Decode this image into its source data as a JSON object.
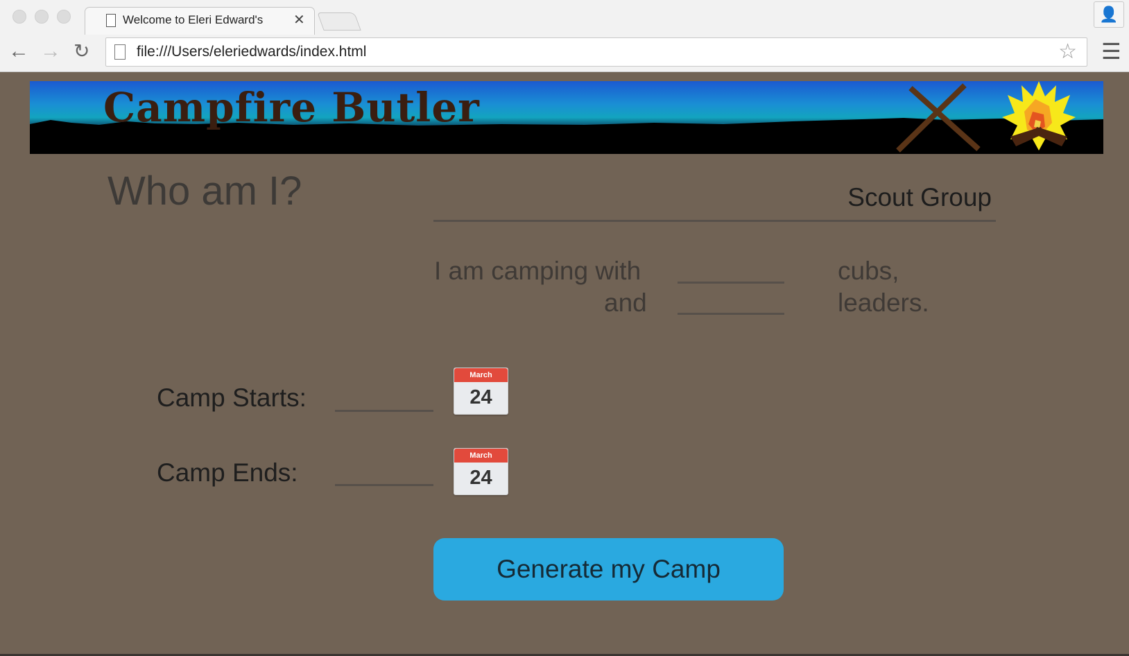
{
  "browser": {
    "tab_title": "Welcome to Eleri Edward's",
    "tab_close": "✕",
    "url": "file:///Users/eleriedwards/index.html",
    "icons": [
      "back-arrow-icon",
      "forward-arrow-icon",
      "reload-icon",
      "bookmark-star-icon",
      "menu-icon",
      "profile-icon"
    ]
  },
  "banner": {
    "title": "Campfire Butler",
    "title_color": "#3a1e10",
    "icons": [
      "crossed-sticks-icon",
      "campfire-icon"
    ]
  },
  "who": {
    "heading": "Who am I?",
    "group_value": "Scout Group"
  },
  "camping": {
    "line1_prefix": "I am camping with",
    "line1_suffix": "cubs,",
    "line2_prefix": "and",
    "line2_suffix": "leaders."
  },
  "dates": {
    "start_label": "Camp Starts:",
    "end_label": "Camp Ends:",
    "start_calendar": {
      "month": "March",
      "day": "24"
    },
    "end_calendar": {
      "month": "March",
      "day": "24"
    }
  },
  "actions": {
    "generate_label": "Generate my Camp",
    "button_color": "#2aa9e0"
  },
  "colors": {
    "page_background": "#716355"
  }
}
